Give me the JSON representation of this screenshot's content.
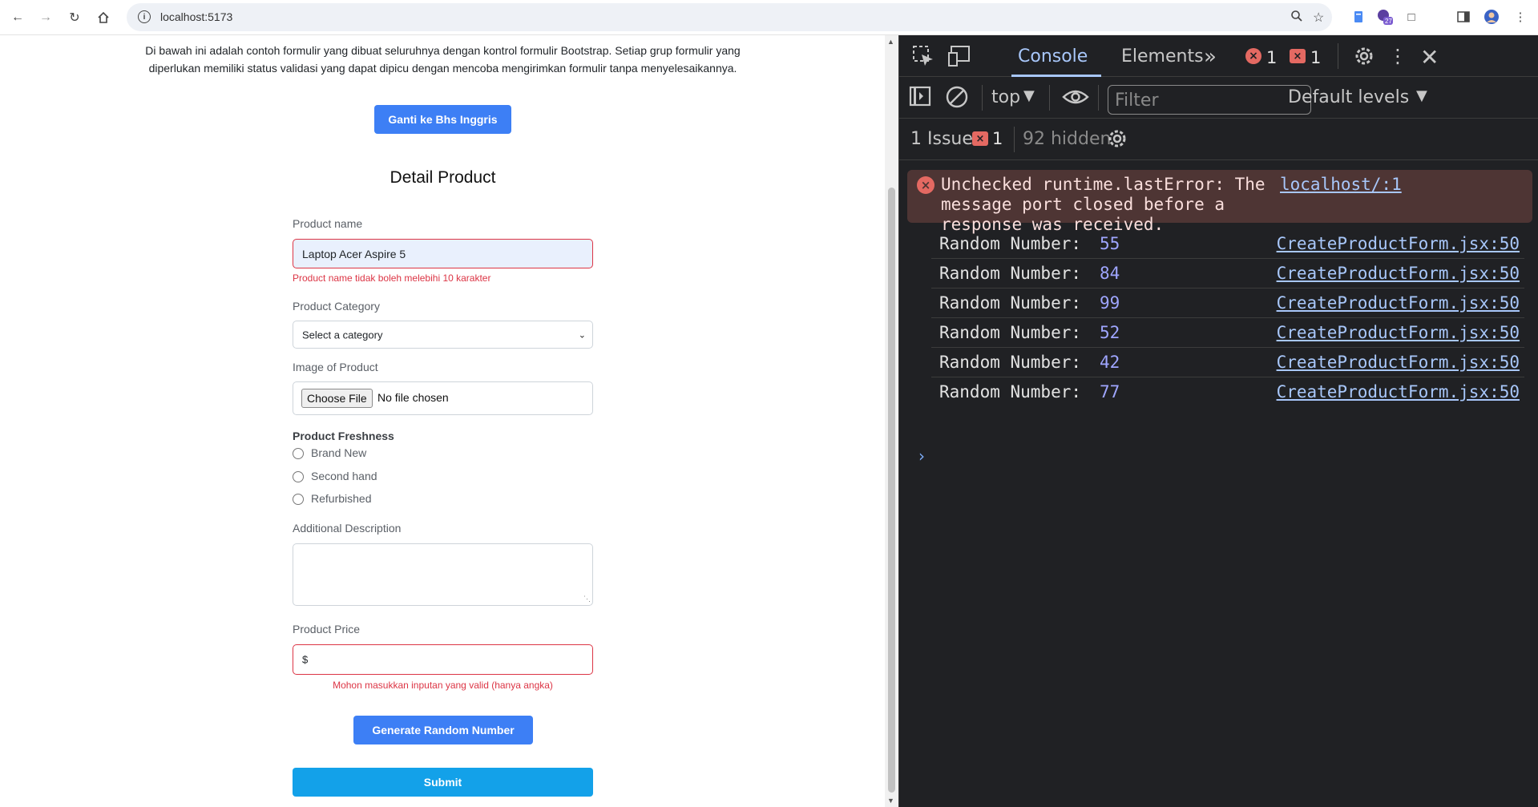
{
  "browser": {
    "url": "localhost:5173",
    "ext_badge": "27"
  },
  "page": {
    "intro": "Di bawah ini adalah contoh formulir yang dibuat seluruhnya dengan kontrol formulir Bootstrap. Setiap grup formulir yang diperlukan memiliki status validasi yang dapat dipicu dengan mencoba mengirimkan formulir tanpa menyelesaikannya.",
    "lang_button": "Ganti ke Bhs Inggris",
    "form_title": "Detail Product",
    "product_name": {
      "label": "Product name",
      "value": "Laptop Acer Aspire 5",
      "error": "Product name tidak boleh melebihi 10 karakter"
    },
    "category": {
      "label": "Product Category",
      "selected": "Select a category"
    },
    "image": {
      "label": "Image of Product",
      "button": "Choose File",
      "status": "No file chosen"
    },
    "freshness": {
      "label": "Product Freshness",
      "options": [
        "Brand New",
        "Second hand",
        "Refurbished"
      ]
    },
    "description": {
      "label": "Additional Description",
      "value": ""
    },
    "price": {
      "label": "Product Price",
      "value": "$",
      "error": "Mohon masukkan inputan yang valid (hanya angka)"
    },
    "random_button": "Generate Random Number",
    "submit_button": "Submit"
  },
  "devtools": {
    "tabs": {
      "console": "Console",
      "elements": "Elements"
    },
    "error_count": "1",
    "warning_count": "1",
    "context": "top",
    "filter_placeholder": "Filter",
    "levels": "Default levels",
    "issues": {
      "label": "1 Issue:",
      "count": "1",
      "hidden": "92 hidden"
    },
    "error_message": {
      "text": "Unchecked runtime.lastError: The message port closed before a response was received.",
      "source": "localhost/:1"
    },
    "logs": [
      {
        "label": "Random Number:",
        "value": "55",
        "source": "CreateProductForm.jsx:50"
      },
      {
        "label": "Random Number:",
        "value": "84",
        "source": "CreateProductForm.jsx:50"
      },
      {
        "label": "Random Number:",
        "value": "99",
        "source": "CreateProductForm.jsx:50"
      },
      {
        "label": "Random Number:",
        "value": "52",
        "source": "CreateProductForm.jsx:50"
      },
      {
        "label": "Random Number:",
        "value": "42",
        "source": "CreateProductForm.jsx:50"
      },
      {
        "label": "Random Number:",
        "value": "77",
        "source": "CreateProductForm.jsx:50"
      }
    ]
  },
  "colors": {
    "primary_button": "#3d7ff5",
    "submit_button": "#13a1e9",
    "error": "#dc3545",
    "devtools_bg": "#202124"
  }
}
